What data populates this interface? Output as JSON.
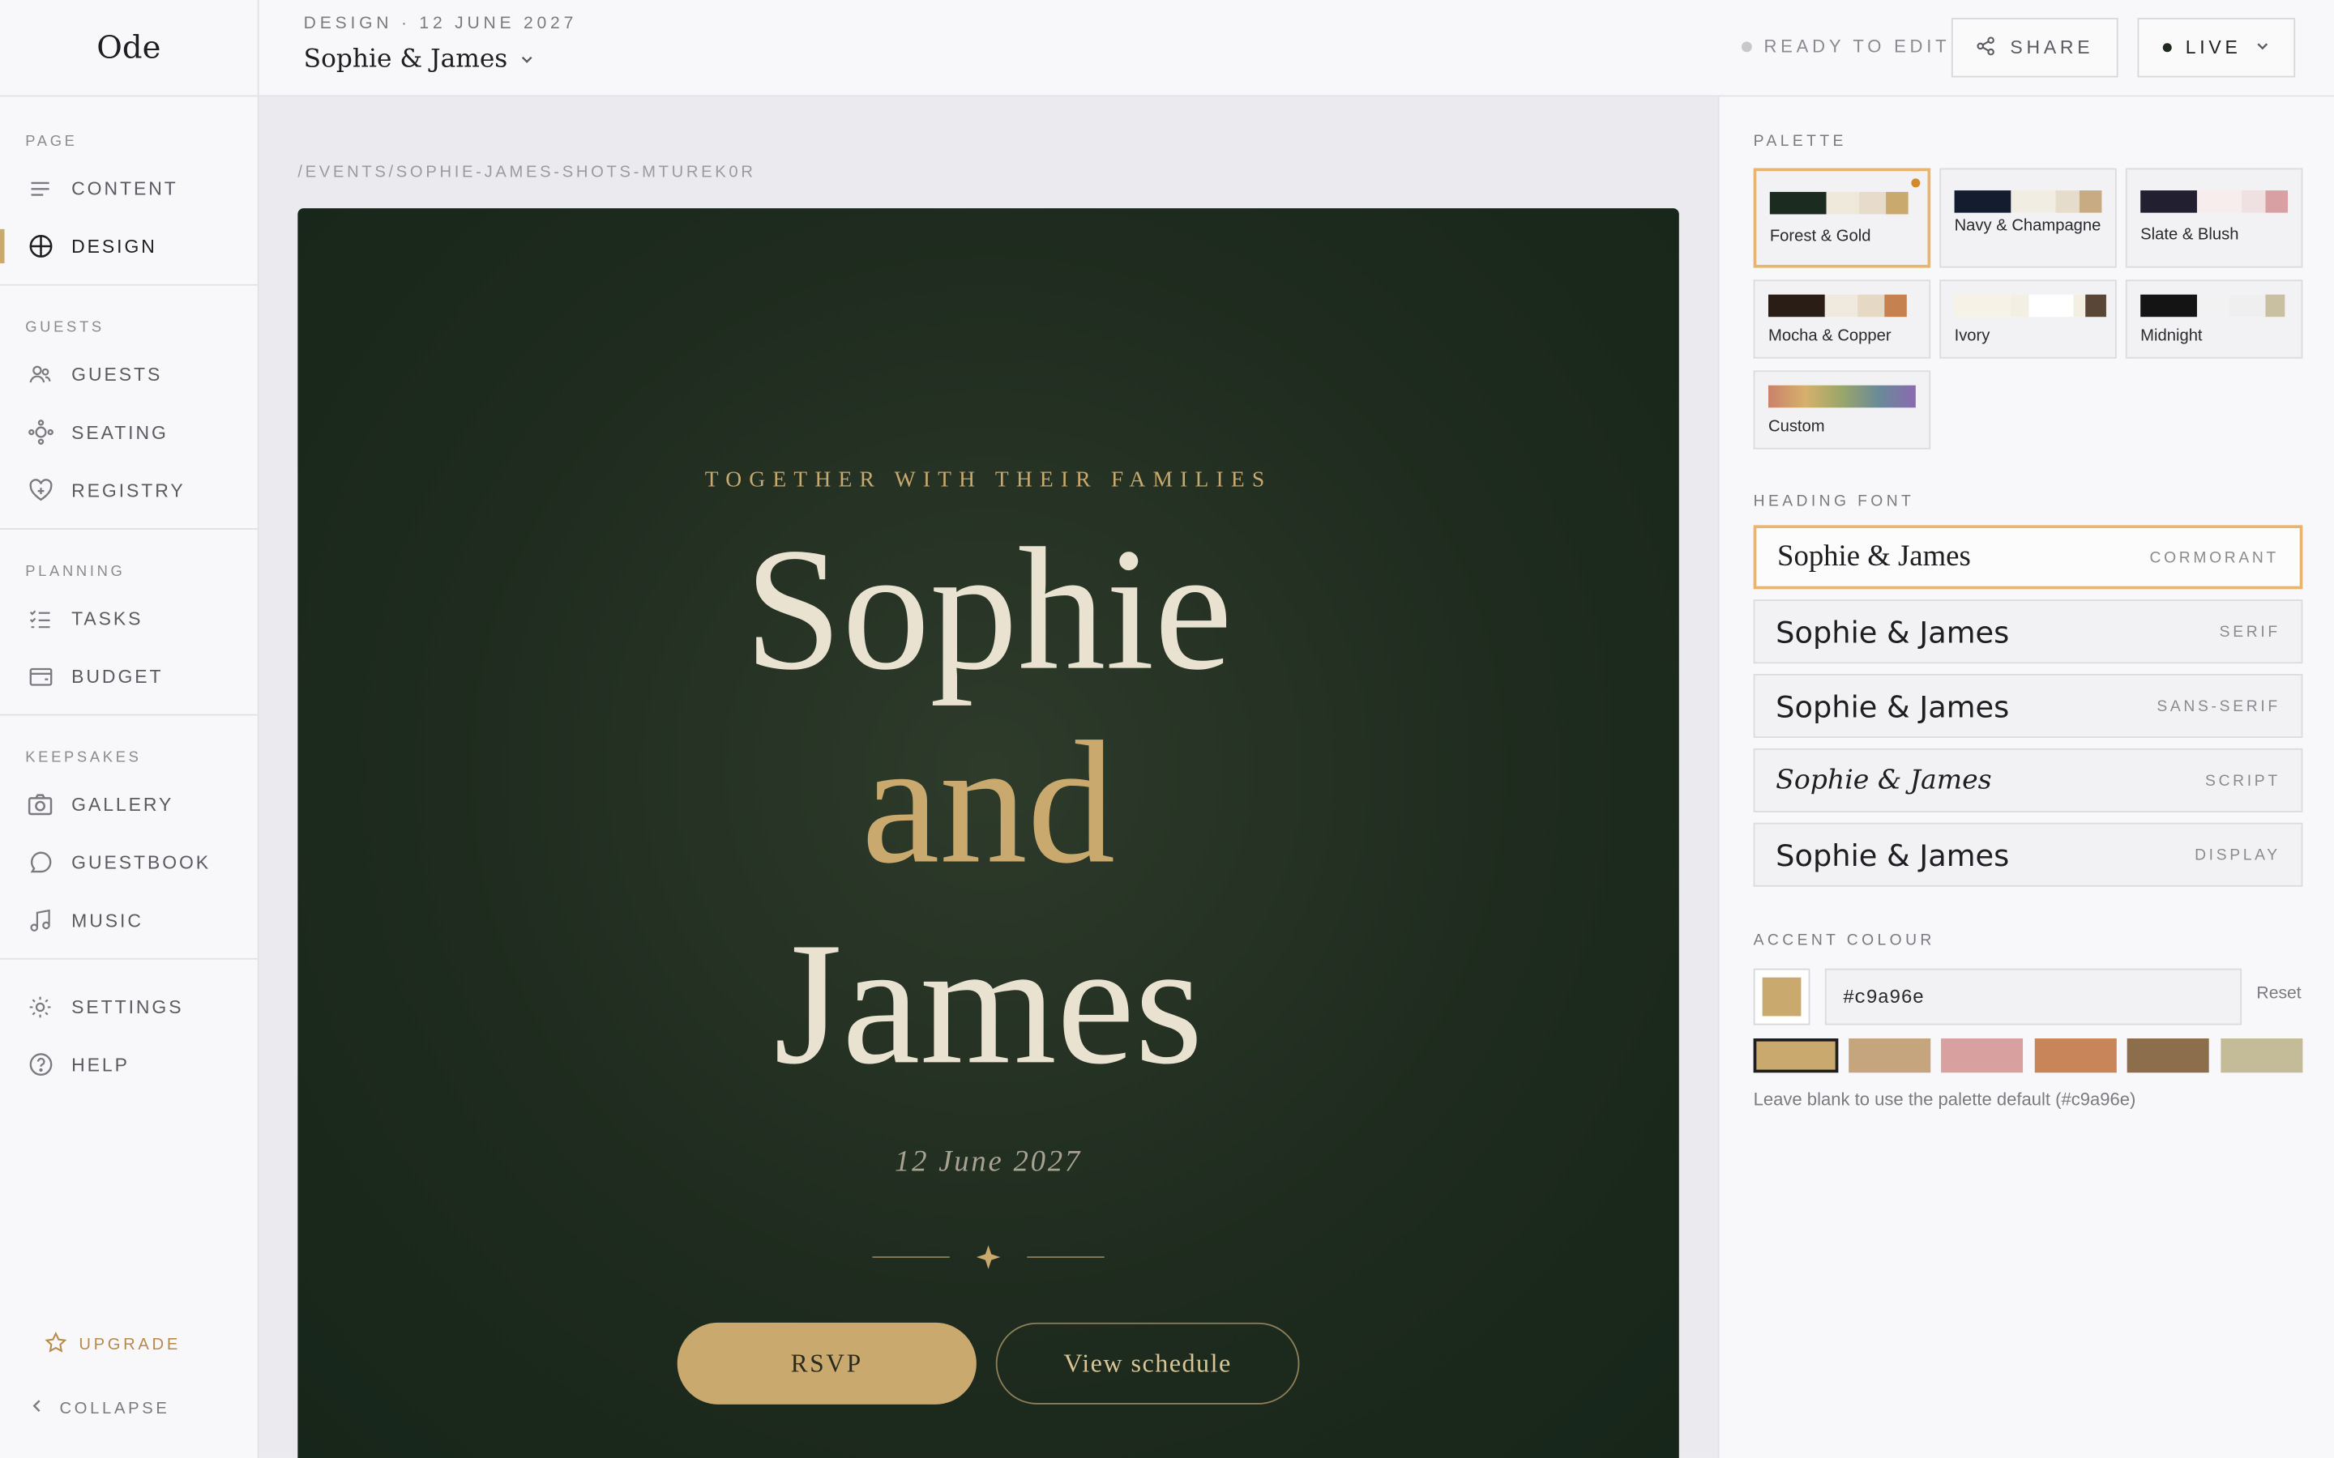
{
  "app": {
    "logo": "Ode"
  },
  "sidebar": {
    "sections": [
      {
        "title": "PAGE",
        "items": [
          {
            "label": "CONTENT",
            "icon": "content-lines-icon"
          },
          {
            "label": "DESIGN",
            "icon": "globe-icon",
            "active": true
          }
        ]
      },
      {
        "title": "GUESTS",
        "items": [
          {
            "label": "GUESTS",
            "icon": "users-icon"
          },
          {
            "label": "SEATING",
            "icon": "seating-icon"
          },
          {
            "label": "REGISTRY",
            "icon": "heart-icon"
          }
        ]
      },
      {
        "title": "PLANNING",
        "items": [
          {
            "label": "TASKS",
            "icon": "checklist-icon"
          },
          {
            "label": "BUDGET",
            "icon": "wallet-icon"
          }
        ]
      },
      {
        "title": "KEEPSAKES",
        "items": [
          {
            "label": "GALLERY",
            "icon": "camera-icon"
          },
          {
            "label": "GUESTBOOK",
            "icon": "chat-bubble-icon"
          },
          {
            "label": "MUSIC",
            "icon": "music-note-icon"
          }
        ]
      }
    ],
    "settings": "SETTINGS",
    "help": "HELP",
    "upgrade": "UPGRADE",
    "collapse": "COLLAPSE"
  },
  "header": {
    "crumb": "DESIGN · 12 JUNE 2027",
    "event_name": "Sophie & James",
    "status": "READY TO EDIT",
    "share": "SHARE",
    "live": "LIVE"
  },
  "canvas": {
    "path": "/EVENTS/SOPHIE-JAMES-SHOTS-MTUREK0R",
    "together": "TOGETHER WITH THEIR FAMILIES",
    "name1": "Sophie",
    "and": "and",
    "name2": "James",
    "date": "12 June 2027",
    "rsvp": "RSVP",
    "schedule": "View schedule"
  },
  "panel": {
    "palette_title": "PALETTE",
    "palettes": [
      {
        "name": "Forest & Gold",
        "colors": [
          "#1c2b1f",
          "#efe9dc",
          "#e7dccb",
          "#c9a96e"
        ],
        "selected": true
      },
      {
        "name": "Navy & Champagne",
        "colors": [
          "#141d30",
          "#f2ede2",
          "#e6dccb",
          "#c9ab83"
        ]
      },
      {
        "name": "Slate & Blush",
        "colors": [
          "#221f30",
          "#f7eded",
          "#efe1e1",
          "#d9a0a3"
        ]
      },
      {
        "name": "Mocha & Copper",
        "colors": [
          "#2a1d15",
          "#f0e9de",
          "#e5d9c6",
          "#c58250"
        ]
      },
      {
        "name": "Ivory",
        "colors": [
          "#f7f2e6",
          "#f4efe3",
          "#ffffff",
          "#5a4636"
        ]
      },
      {
        "name": "Midnight",
        "colors": [
          "#141414",
          "#f2f2f2",
          "#efefef",
          "#c8c0a0"
        ]
      },
      {
        "name": "Custom",
        "colors": [
          "gradient"
        ]
      }
    ],
    "font_title": "HEADING FONT",
    "fonts": [
      {
        "sample": "Sophie & James",
        "tag": "CORMORANT",
        "selected": true
      },
      {
        "sample": "Sophie & James",
        "tag": "SERIF"
      },
      {
        "sample": "Sophie & James",
        "tag": "SANS-SERIF"
      },
      {
        "sample": "Sophie & James",
        "tag": "SCRIPT"
      },
      {
        "sample": "Sophie & James",
        "tag": "DISPLAY"
      }
    ],
    "accent_title": "ACCENT COLOUR",
    "accent_value": "#c9a96e",
    "reset": "Reset",
    "accent_chips": [
      "#c9a96e",
      "#c4a57e",
      "#d9a0a0",
      "#c8855a",
      "#8c6d4c",
      "#c4bb98"
    ],
    "hint": "Leave blank to use the palette default (#c9a96e)"
  }
}
